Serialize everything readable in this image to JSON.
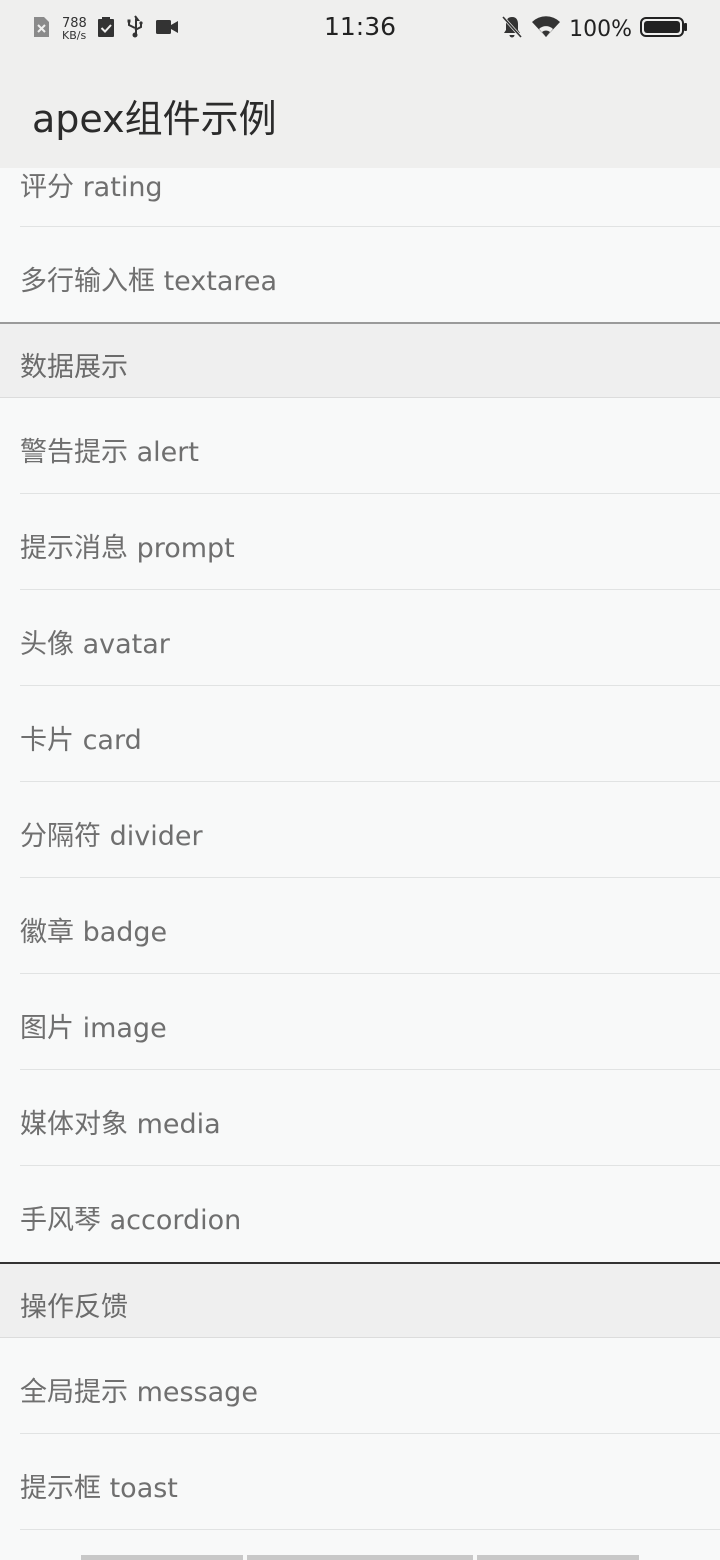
{
  "status_bar": {
    "net_speed_value": "788",
    "net_speed_unit": "KB/s",
    "time": "11:36",
    "battery": "100%",
    "icons_left": [
      "sim-x-icon",
      "clipboard-check-icon",
      "usb-icon",
      "video-camera-icon"
    ],
    "icons_right": [
      "bell-off-icon",
      "wifi-icon",
      "battery-icon"
    ]
  },
  "app_bar": {
    "title": "apex组件示例"
  },
  "list": {
    "top_items": [
      {
        "label": "评分 rating"
      },
      {
        "label": "多行输入框 textarea"
      }
    ],
    "section_data_display": {
      "header": "数据展示",
      "items": [
        {
          "label": "警告提示 alert"
        },
        {
          "label": "提示消息 prompt"
        },
        {
          "label": "头像 avatar"
        },
        {
          "label": "卡片 card"
        },
        {
          "label": "分隔符 divider"
        },
        {
          "label": "徽章 badge"
        },
        {
          "label": "图片 image"
        },
        {
          "label": "媒体对象 media"
        },
        {
          "label": "手风琴 accordion"
        }
      ]
    },
    "section_feedback": {
      "header": "操作反馈",
      "items": [
        {
          "label": "全局提示 message"
        },
        {
          "label": "提示框 toast"
        }
      ]
    }
  },
  "colors": {
    "bar_background": "#efefee",
    "list_background": "#f8f9f9",
    "label_text": "#6f6f6f",
    "divider": "#e1e3e3"
  }
}
